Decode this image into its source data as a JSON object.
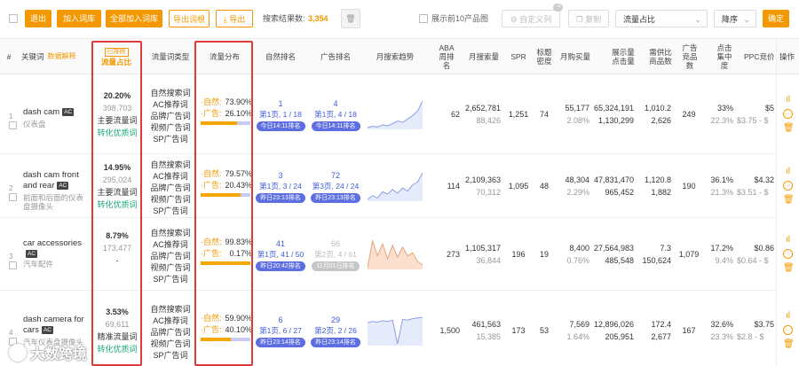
{
  "toolbar": {
    "exit": "退出",
    "add_keyword": "加入词库",
    "add_all": "全部加入词库",
    "export_cn": "导出词根",
    "export": "导出",
    "result_label": "搜索结果数:",
    "result_count": "3,354",
    "show_top10": "展示前10产品图",
    "custom_column": "自定义列",
    "custom_badge": "-4",
    "copy": "复制",
    "sort_field": "流量占比",
    "sort_order": "降序",
    "confirm": "确定"
  },
  "header": {
    "index": "#",
    "keyword": "关键词",
    "keyword_link": "数据解释",
    "traffic_share": "流量占比",
    "traffic_tag": "已排除",
    "traffic_type": "流量词类型",
    "traffic_dist": "流量分布",
    "natural_rank": "自然排名",
    "ad_rank": "广告排名",
    "monthly_trend": "月搜索趋势",
    "aba": "ABA周排名",
    "monthly_search": "月搜索量",
    "spr": "SPR",
    "title_density": "标题密度",
    "monthly_buy": "月购买量",
    "display_click": "展示量点击量",
    "demand": "需供比商品数",
    "ad_products": "广告竞品数",
    "click_conc": "点击集中度",
    "ppc": "PPC竞价",
    "ops": "操作"
  },
  "rows": [
    {
      "index": "1",
      "keyword": "dash cam",
      "ac": "AC",
      "zh": "仪表盘",
      "share": "20.20%",
      "share_val": "398,703",
      "share_type": "主要流量词",
      "share_tag": "转化优质词",
      "types": [
        "自然搜索词",
        "AC推荐词",
        "品牌广告词",
        "视频广告词",
        "SP广告词"
      ],
      "natural_label": "·自然:",
      "natural_pct": "73.90%",
      "ad_label": "·广告:",
      "ad_pct": "26.10%",
      "natural_frac": 0.739,
      "nat_rank_top": "1",
      "nat_rank": "第1页, 1 / 18",
      "nat_time": "今日14:11排名",
      "ad_rank_top": "4",
      "ad_rank": "第1页, 4 / 18",
      "ad_time": "今日14:11排名",
      "trend": [
        20,
        22,
        21,
        24,
        23,
        26,
        30,
        28,
        33,
        38,
        45,
        60
      ],
      "aba": "62",
      "search1": "2,652,781",
      "search2": "88,426",
      "spr": "1,251",
      "density": "74",
      "buy1": "55,177",
      "buy2": "2.08%",
      "disp1": "65,324,191",
      "disp2": "1,130,299",
      "dem1": "1,010.2",
      "dem2": "2,626",
      "adprod": "249",
      "conc1": "33%",
      "conc2": "22.3%",
      "ppc1": "$5",
      "ppc2": "$3.75 - $"
    },
    {
      "index": "2",
      "keyword": "dash cam front and rear",
      "ac": "AC",
      "zh": "前面和后面的仪表盘摄像头",
      "share": "14.95%",
      "share_val": "295,024",
      "share_type": "主要流量词",
      "share_tag": "转化优质词",
      "types": [
        "自然搜索词",
        "AC推荐词",
        "品牌广告词",
        "视频广告词",
        "SP广告词"
      ],
      "natural_label": "·自然:",
      "natural_pct": "79.57%",
      "ad_label": "·广告:",
      "ad_pct": "20.43%",
      "natural_frac": 0.7957,
      "nat_rank_top": "3",
      "nat_rank": "第1页, 3 / 24",
      "nat_time": "昨日23:13排名",
      "ad_rank_top": "72",
      "ad_rank": "第3页, 24 / 24",
      "ad_time": "昨日23:13排名",
      "trend": [
        25,
        30,
        27,
        35,
        32,
        38,
        33,
        40,
        36,
        44,
        48,
        60
      ],
      "aba": "114",
      "search1": "2,109,363",
      "search2": "70,312",
      "spr": "1,095",
      "density": "48",
      "buy1": "48,304",
      "buy2": "2.29%",
      "disp1": "47,831,470",
      "disp2": "965,452",
      "dem1": "1,120.8",
      "dem2": "1,882",
      "adprod": "190",
      "conc1": "36.1%",
      "conc2": "21.3%",
      "ppc1": "$4.32",
      "ppc2": "$3.51 - $"
    },
    {
      "index": "3",
      "keyword": "car accessories",
      "ac": "AC",
      "zh": "汽车配件",
      "share": "8.79%",
      "share_val": "173,477",
      "share_type": "-",
      "share_tag": "",
      "types": [
        "自然搜索词",
        "AC推荐词",
        "品牌广告词",
        "视频广告词",
        "SP广告词"
      ],
      "natural_label": "·自然:",
      "natural_pct": "99.83%",
      "ad_label": "·广告:",
      "ad_pct": "0.17%",
      "natural_frac": 0.9983,
      "nat_rank_top": "41",
      "nat_rank": "第1页, 41 / 50",
      "nat_time": "昨日20:42排名",
      "ad_rank_top": "66",
      "ad_rank": "第2页, 4 / 61",
      "ad_time": "11月01日排名",
      "trend": [
        10,
        55,
        30,
        50,
        25,
        48,
        28,
        45,
        30,
        35,
        20,
        15
      ],
      "aba": "273",
      "search1": "1,105,317",
      "search2": "36,844",
      "spr": "196",
      "density": "19",
      "buy1": "8,400",
      "buy2": "0.76%",
      "disp1": "27,564,983",
      "disp2": "485,548",
      "dem1": "7.3",
      "dem2": "150,624",
      "adprod": "1,079",
      "conc1": "17.2%",
      "conc2": "9.4%",
      "ppc1": "$0.86",
      "ppc2": "$0.64 - $"
    },
    {
      "index": "4",
      "keyword": "dash camera for cars",
      "ac": "AC",
      "zh": "汽车仪表盘摄像头",
      "share": "3.53%",
      "share_val": "69,611",
      "share_type": "精准流量词",
      "share_tag": "转化优质词",
      "types": [
        "自然搜索词",
        "AC推荐词",
        "品牌广告词",
        "视频广告词",
        "SP广告词"
      ],
      "natural_label": "·自然:",
      "natural_pct": "59.90%",
      "ad_label": "·广告:",
      "ad_pct": "40.10%",
      "natural_frac": 0.599,
      "nat_rank_top": "6",
      "nat_rank": "第1页, 6 / 27",
      "nat_time": "昨日23:14排名",
      "ad_rank_top": "29",
      "ad_rank": "第2页, 2 / 26",
      "ad_time": "昨日23:14排名",
      "trend": [
        40,
        42,
        41,
        43,
        42,
        44,
        10,
        45,
        44,
        46,
        47,
        48
      ],
      "aba": "1,500",
      "search1": "461,563",
      "search2": "15,385",
      "spr": "173",
      "density": "53",
      "buy1": "7,569",
      "buy2": "1.64%",
      "disp1": "12,896,026",
      "disp2": "205,951",
      "dem1": "172.4",
      "dem2": "2,677",
      "adprod": "167",
      "conc1": "32.6%",
      "conc2": "23.3%",
      "ppc1": "$3.75",
      "ppc2": "$2.8 - $"
    }
  ],
  "watermark": "大数跨境",
  "colors": {
    "accent": "#f39800",
    "link": "#3b5bdb",
    "green": "#19a974",
    "highlight": "#e03b3b"
  }
}
